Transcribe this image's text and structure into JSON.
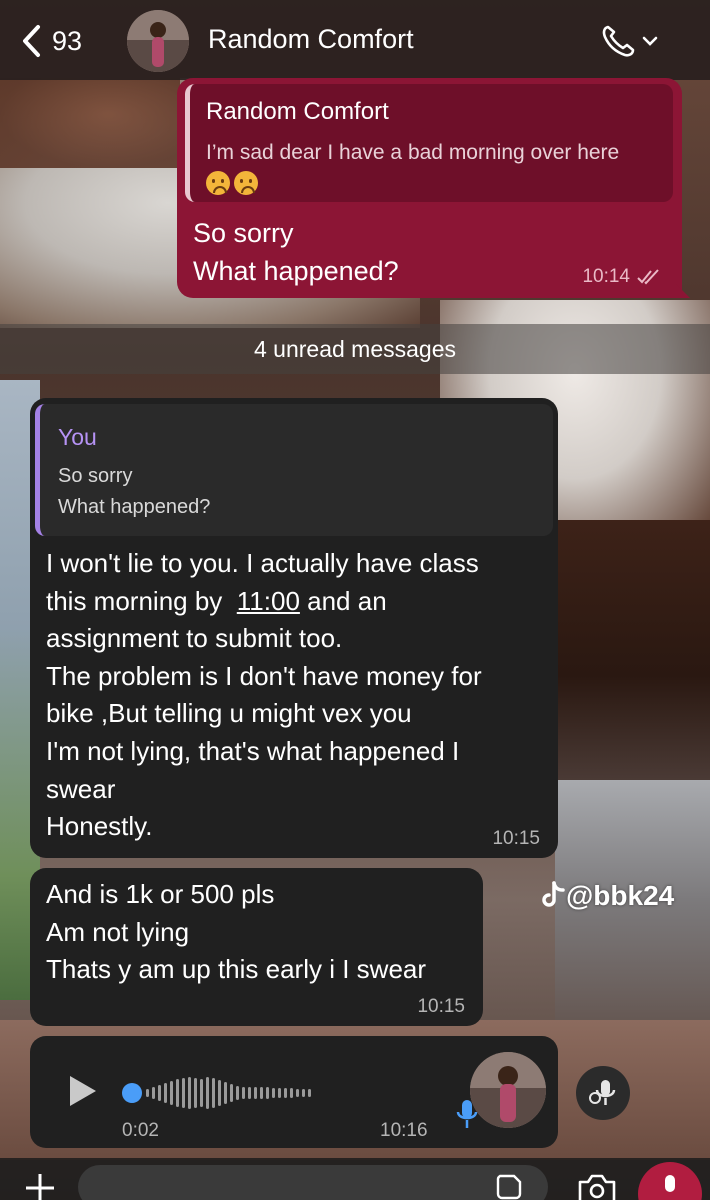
{
  "header": {
    "back_count": "93",
    "contact_name": "Random Comfort"
  },
  "sent_message": {
    "quote_name": "Random Comfort",
    "quote_text": "I’m sad dear I have a bad morning over here",
    "quote_emojis": [
      "frowning-face-emoji",
      "frowning-face-emoji"
    ],
    "line1": "So sorry",
    "line2": "What happened?",
    "time": "10:14",
    "status": "read"
  },
  "unread_banner": "4 unread messages",
  "received_1": {
    "quote_name": "You",
    "quote_line1": "So sorry",
    "quote_line2": "What happened?",
    "lines": [
      "I won't lie to you. I actually have class",
      "this morning by",
      "11:00",
      "and an",
      "assignment to submit too.",
      "The problem is I don't have money for",
      "bike ,But telling u might vex you",
      "I'm not lying, that's what happened I",
      "swear",
      "Honestly."
    ],
    "time": "10:15"
  },
  "received_2": {
    "lines": [
      "And is 1k or 500 pls",
      "Am not lying",
      "Thats y am up this early i I swear"
    ],
    "time": "10:15"
  },
  "voice_note": {
    "duration": "0:02",
    "time": "10:16",
    "progress": 0
  },
  "watermark": "@bbk24",
  "input": {
    "placeholder": ""
  },
  "colors": {
    "sent_bubble": "#8c1535",
    "received_bubble": "#202020",
    "quote_accent": "#a582e6",
    "mic_button": "#b11d40",
    "play_progress": "#4a9df8"
  }
}
